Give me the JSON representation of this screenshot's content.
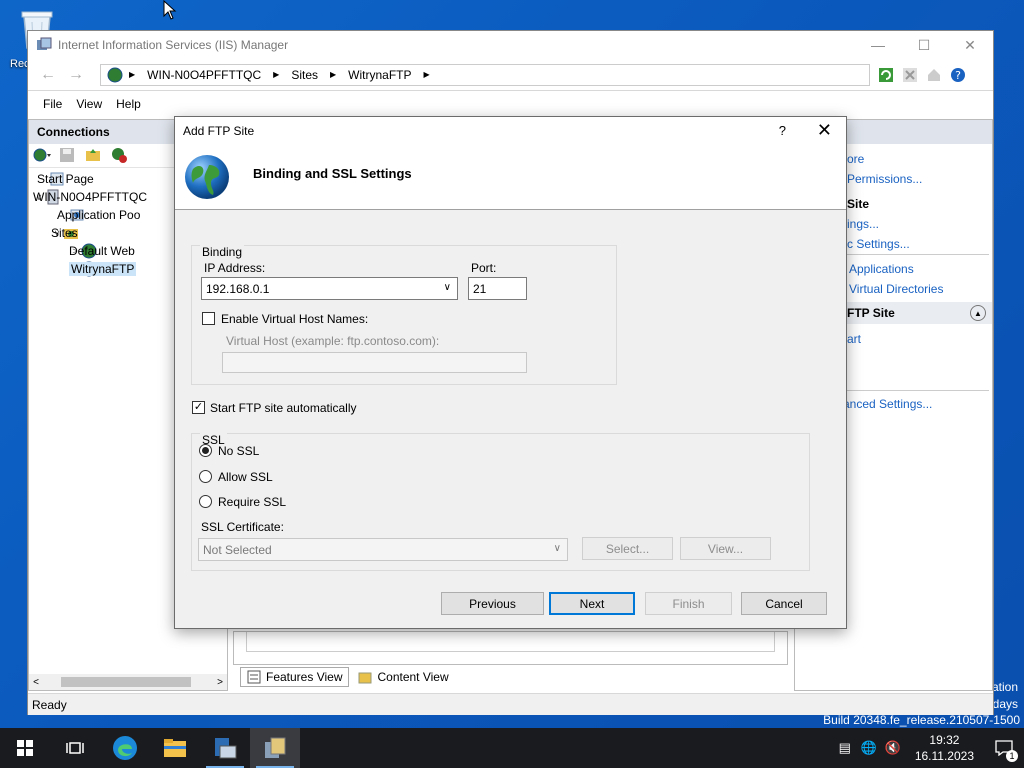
{
  "desktop": {
    "recycle_bin_label": "Rec",
    "watermark_line1": "ation",
    "watermark_line2": "days",
    "watermark_build": "Build 20348.fe_release.210507-1500"
  },
  "iis": {
    "title": "Internet Information Services (IIS) Manager",
    "breadcrumb": [
      "WIN-N0O4PFFTTQC",
      "Sites",
      "WitrynaFTP"
    ],
    "menu": [
      "File",
      "View",
      "Help"
    ],
    "connections_header": "Connections",
    "tree": [
      {
        "label": "Start Page"
      },
      {
        "label": "WIN-N0O4PFFTTQC"
      },
      {
        "label": "Application Poo"
      },
      {
        "label": "Sites"
      },
      {
        "label": "Default Web"
      },
      {
        "label": "WitrynaFTP"
      }
    ],
    "actions": {
      "link1": "ore",
      "link2": "Permissions...",
      "head1": "Site",
      "link3": "ings...",
      "link4": "c Settings...",
      "link5": "Applications",
      "link6": "Virtual Directories",
      "group": "FTP Site",
      "link7": "art",
      "link8": "anced Settings..."
    },
    "view_tabs": [
      "Features View",
      "Content View"
    ],
    "status": "Ready"
  },
  "dialog": {
    "title": "Add FTP Site",
    "help": "?",
    "heading": "Binding and SSL Settings",
    "binding_group": "Binding",
    "ip_label": "IP Address:",
    "ip_value": "192.168.0.1",
    "port_label": "Port:",
    "port_value": "21",
    "vhost_check_label": "Enable Virtual Host Names:",
    "vhost_label": "Virtual Host (example: ftp.contoso.com):",
    "vhost_value": "",
    "start_auto_label": "Start FTP site automatically",
    "start_auto_checked": true,
    "ssl_group": "SSL",
    "ssl_options": [
      "No SSL",
      "Allow SSL",
      "Require SSL"
    ],
    "ssl_selected": "No SSL",
    "cert_label": "SSL Certificate:",
    "cert_value": "Not Selected",
    "select_btn": "Select...",
    "view_btn": "View...",
    "buttons": {
      "previous": "Previous",
      "next": "Next",
      "finish": "Finish",
      "cancel": "Cancel"
    }
  },
  "taskbar": {
    "time": "19:32",
    "date": "16.11.2023",
    "notification_count": "1"
  }
}
